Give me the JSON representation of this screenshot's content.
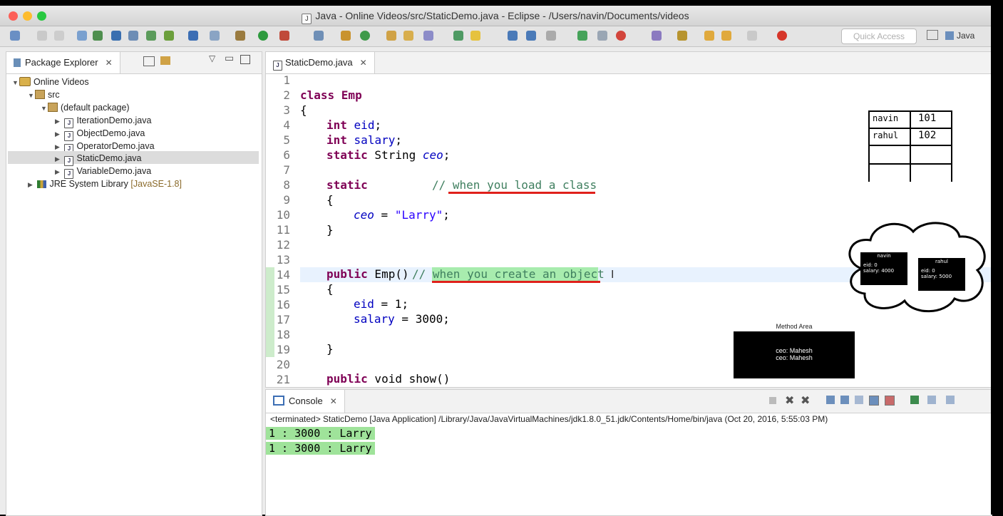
{
  "window": {
    "title": "Java - Online Videos/src/StaticDemo.java - Eclipse - /Users/navin/Documents/videos",
    "title_icon": "J"
  },
  "toolbar": {
    "quick_access_placeholder": "Quick Access",
    "perspective_label": "Java"
  },
  "package_explorer": {
    "tab_label": "Package Explorer",
    "project": "Online Videos",
    "src": "src",
    "package": "(default package)",
    "files": [
      "IterationDemo.java",
      "ObjectDemo.java",
      "OperatorDemo.java",
      "StaticDemo.java",
      "VariableDemo.java"
    ],
    "library": "JRE System Library",
    "library_version": "[JavaSE-1.8]"
  },
  "editor": {
    "tab_label": "StaticDemo.java",
    "line_numbers": [
      "1",
      "2",
      "3",
      "4",
      "5",
      "6",
      "7",
      "8",
      "9",
      "10",
      "11",
      "12",
      "13",
      "14",
      "15",
      "16",
      "17",
      "18",
      "19",
      "20",
      "21"
    ],
    "code": {
      "l2": "class Emp",
      "l3": "{",
      "int": "int",
      "eid": "eid",
      "salary": "salary",
      "semicolon": ";",
      "static": "static",
      "String": " String ",
      "ceo": "ceo",
      "cmt_load": "// when you load a class",
      "open_brace": "{",
      "close_brace": "}",
      "ceo_assign_op": " = ",
      "larry": "\"Larry\"",
      "public": "public",
      "emp_ctor": " Emp() ",
      "cmt_create": "// when you create an object",
      "eid_assign": " = 1;",
      "salary_assign": " = 3000;",
      "void_show": " void ",
      "show": "show()"
    }
  },
  "overlay": {
    "table_rows": [
      [
        "navin",
        "101"
      ],
      [
        "rahul",
        "102"
      ]
    ],
    "heap_objects": [
      {
        "name": "navin",
        "eid": "eid: 0",
        "salary": "salary: 4000"
      },
      {
        "name": "rahul",
        "eid": "eid: 0",
        "salary": "salary: 5000"
      }
    ],
    "method_area_label": "Method Area",
    "method_area_lines": [
      "ceo: Mahesh",
      "ceo: Mahesh"
    ]
  },
  "console": {
    "tab_label": "Console",
    "status": "<terminated> StaticDemo [Java Application] /Library/Java/JavaVirtualMachines/jdk1.8.0_51.jdk/Contents/Home/bin/java (Oct 20, 2016, 5:55:03 PM)",
    "output": [
      "1 : 3000 : Larry",
      "1 : 3000 : Larry"
    ]
  }
}
